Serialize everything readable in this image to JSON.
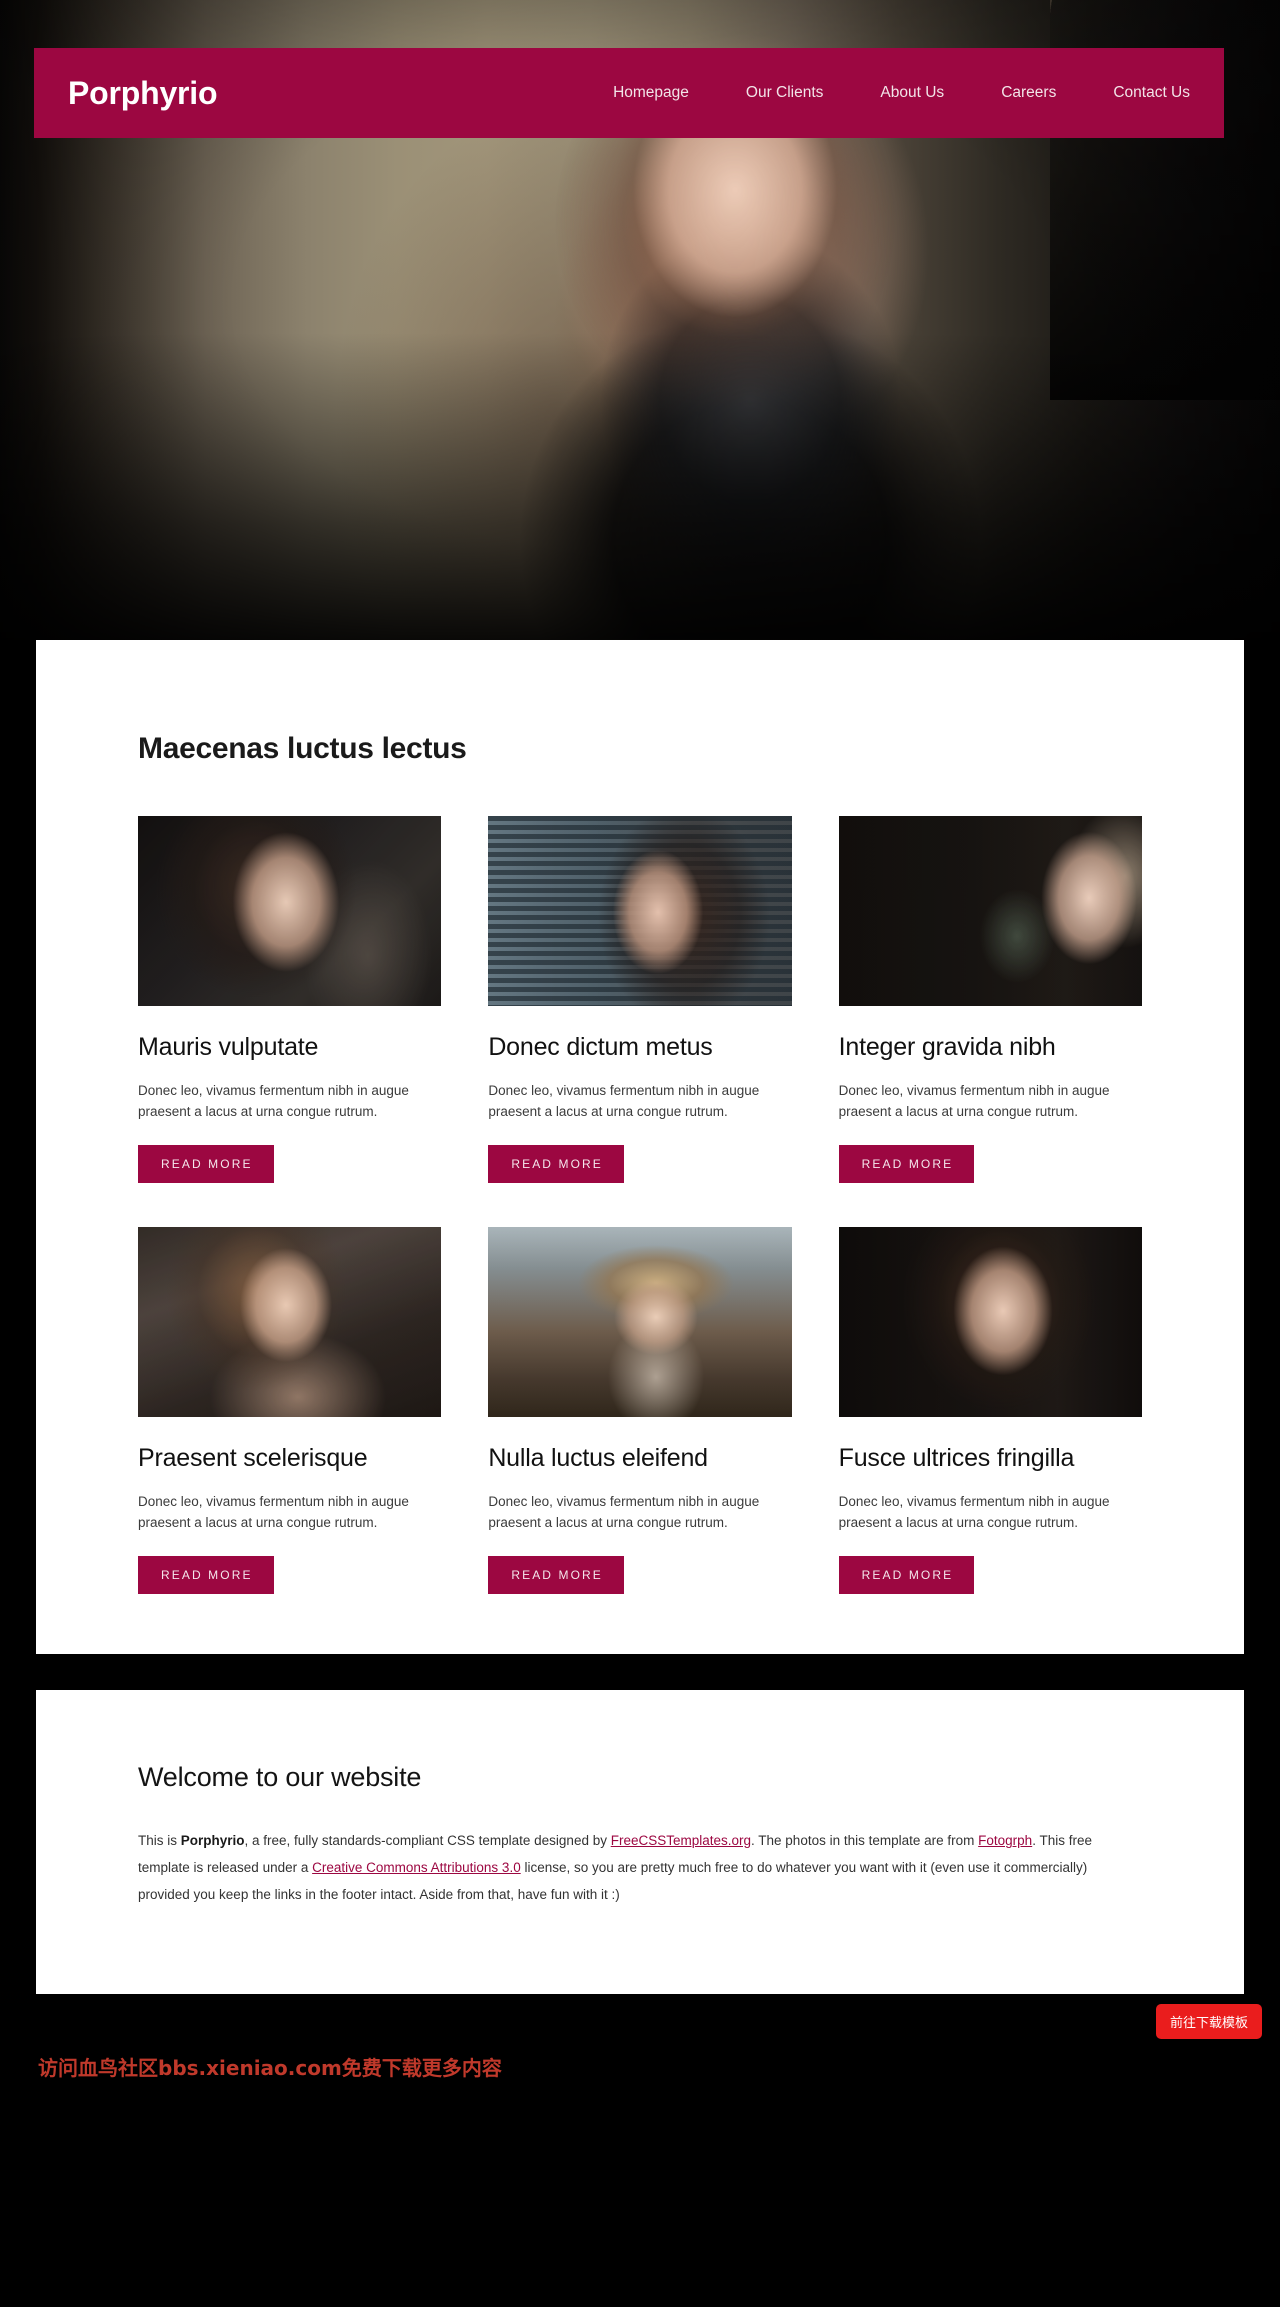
{
  "site": {
    "logo": "Porphyrio",
    "accent_color": "#9c0741",
    "nav": [
      {
        "label": "Homepage"
      },
      {
        "label": "Our Clients"
      },
      {
        "label": "About Us"
      },
      {
        "label": "Careers"
      },
      {
        "label": "Contact Us"
      }
    ]
  },
  "main": {
    "section_title": "Maecenas luctus lectus",
    "body_text": "Donec leo, vivamus fermentum nibh in augue praesent a lacus at urna congue rutrum.",
    "read_more_label": "READ MORE",
    "cards": [
      {
        "title": "Mauris vulputate",
        "text": "Donec leo, vivamus fermentum nibh in augue praesent a lacus at urna congue rutrum.",
        "button": "READ MORE",
        "image": "portrait-woman-dark-profile"
      },
      {
        "title": "Donec dictum metus",
        "text": "Donec leo, vivamus fermentum nibh in augue praesent a lacus at urna congue rutrum.",
        "button": "READ MORE",
        "image": "portrait-woman-window-blinds"
      },
      {
        "title": "Integer gravida nibh",
        "text": "Donec leo, vivamus fermentum nibh in augue praesent a lacus at urna congue rutrum.",
        "button": "READ MORE",
        "image": "portrait-blonde-woman-plant"
      },
      {
        "title": "Praesent scelerisque",
        "text": "Donec leo, vivamus fermentum nibh in augue praesent a lacus at urna congue rutrum.",
        "button": "READ MORE",
        "image": "portrait-woman-warm-light"
      },
      {
        "title": "Nulla luctus eleifend",
        "text": "Donec leo, vivamus fermentum nibh in augue praesent a lacus at urna congue rutrum.",
        "button": "READ MORE",
        "image": "portrait-woman-straw-hat"
      },
      {
        "title": "Fusce ultrices fringilla",
        "text": "Donec leo, vivamus fermentum nibh in augue praesent a lacus at urna congue rutrum.",
        "button": "READ MORE",
        "image": "portrait-woman-dark-background"
      }
    ]
  },
  "footer": {
    "title": "Welcome to our website",
    "part1": "This is ",
    "brand": "Porphyrio",
    "part2": ", a free, fully standards-compliant CSS template designed by ",
    "link1": "FreeCSSTemplates.org",
    "part3": ". The photos in this template are from ",
    "link2": "Fotogrph",
    "part4": ". This free template is released under a ",
    "link3": "Creative Commons Attributions 3.0",
    "part5": " license, so you are pretty much free to do whatever you want with it (even use it commercially) provided you keep the links in the footer intact. Aside from that, have fun with it :)"
  },
  "watermark": {
    "text": "访问血鸟社区bbs.xieniao.com免费下载更多内容",
    "button": "前往下载模板"
  }
}
